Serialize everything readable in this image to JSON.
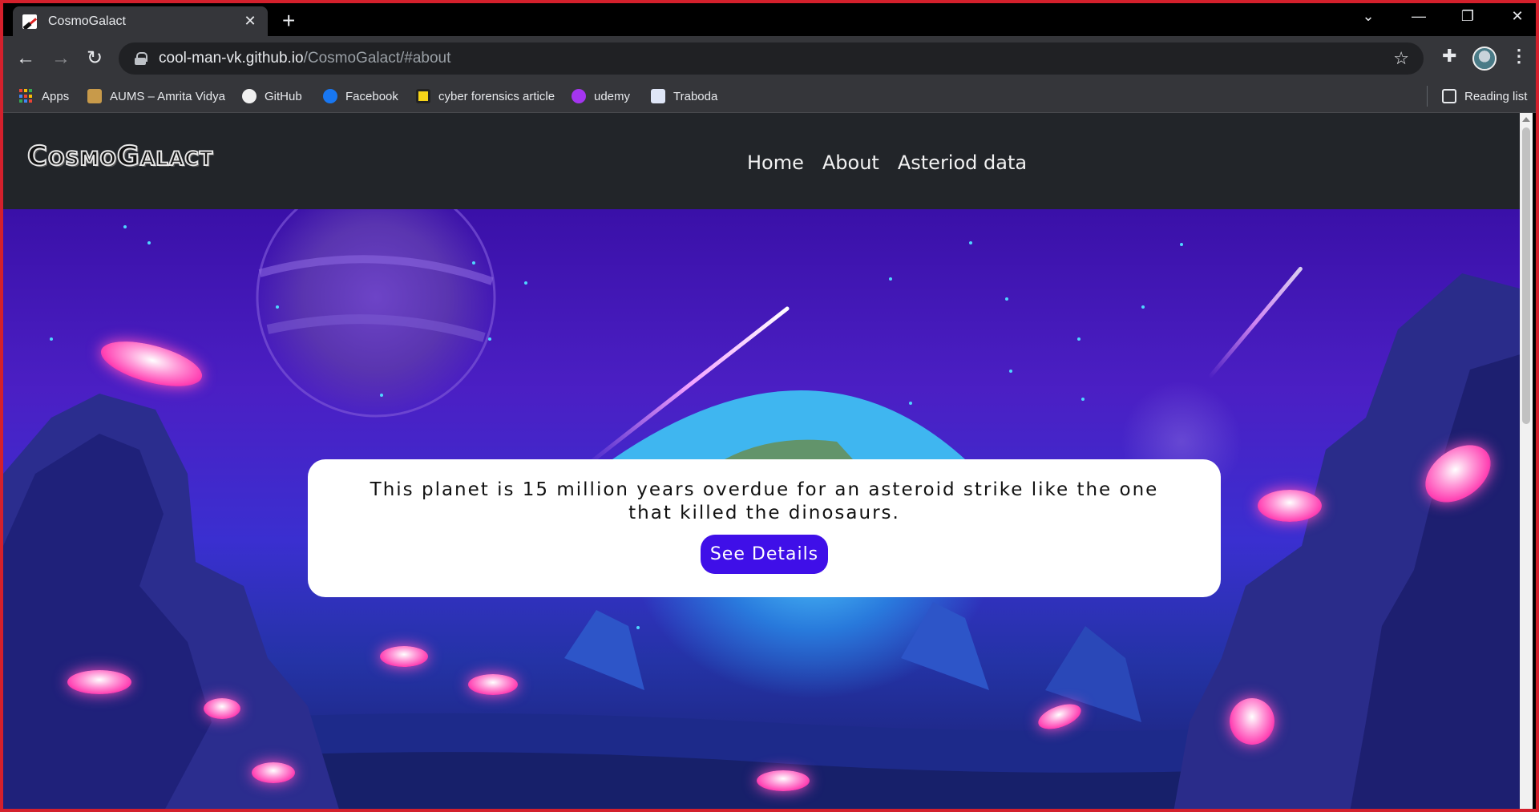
{
  "browser": {
    "tab_title": "CosmoGalact",
    "url_host": "cool-man-vk.github.io",
    "url_path": "/CosmoGalact/#about",
    "bookmarks": [
      {
        "label": "Apps"
      },
      {
        "label": "AUMS – Amrita Vidya"
      },
      {
        "label": "GitHub"
      },
      {
        "label": "Facebook"
      },
      {
        "label": "cyber forensics article"
      },
      {
        "label": "udemy"
      },
      {
        "label": "Traboda"
      }
    ],
    "reading_list": "Reading list"
  },
  "site": {
    "logo": "CosmoGalact",
    "nav": [
      {
        "label": "Home"
      },
      {
        "label": "About"
      },
      {
        "label": "Asteriod data"
      }
    ],
    "hero": {
      "message": "This planet is 15 million years overdue for an asteroid strike like the one that killed the dinosaurs.",
      "button_label": "See Details"
    }
  },
  "colors": {
    "window_border": "#d4202c",
    "header_bg": "#222529",
    "button_bg": "#3f0fe8"
  }
}
